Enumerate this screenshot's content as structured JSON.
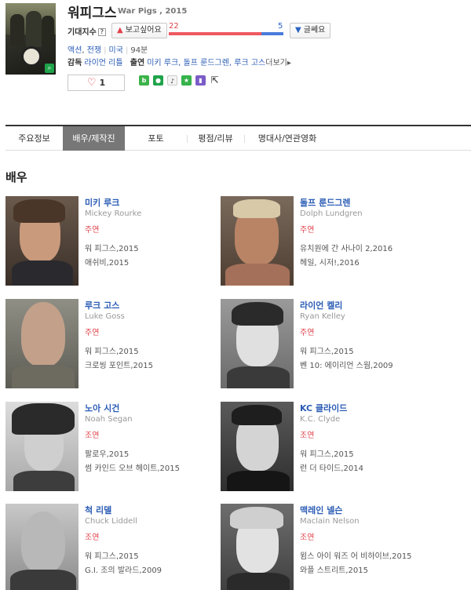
{
  "movie": {
    "title": "워피그스",
    "subtitle": "War Pigs , 2015",
    "expect_label": "기대지수",
    "help_mark": "?",
    "want_label": "보고싶어요",
    "no_label": "글쎄요",
    "want_count": "22",
    "no_count": "5",
    "want_ratio": 0.81,
    "genres": [
      "액션",
      "전쟁"
    ],
    "country": "미국",
    "runtime": "94분",
    "director_label": "감독",
    "director": "라이언 리틀",
    "cast_label": "출연",
    "cast_links": "미키 루크, 돌프 룬드그렌, 루크 고스",
    "more_label": "더보기",
    "like_count": "1"
  },
  "tabs": [
    {
      "label": "주요정보"
    },
    {
      "label": "배우/제작진"
    },
    {
      "label": "포토"
    },
    {
      "label": "평점/리뷰"
    },
    {
      "label": "명대사/연관영화"
    }
  ],
  "active_tab": 1,
  "section_title": "배우",
  "cast": [
    {
      "name": "미키 루크",
      "ename": "Mickey Rourke",
      "role": "주연",
      "films": [
        "워 피그스,2015",
        "애쉬비,2015"
      ]
    },
    {
      "name": "돌프 룬드그렌",
      "ename": "Dolph Lundgren",
      "role": "주연",
      "films": [
        "유치원에 간 사나이 2,2016",
        "헤일, 시저!,2016"
      ]
    },
    {
      "name": "루크 고스",
      "ename": "Luke Goss",
      "role": "주연",
      "films": [
        "워 피그스,2015",
        "크로씽 포인트,2015"
      ]
    },
    {
      "name": "라이언 켈리",
      "ename": "Ryan Kelley",
      "role": "주연",
      "films": [
        "워 피그스,2015",
        "벤 10: 에이리언 스웜,2009"
      ]
    },
    {
      "name": "노아 시건",
      "ename": "Noah Segan",
      "role": "조연",
      "films": [
        "팔로우,2015",
        "썸 카인드 오브 헤이트,2015"
      ]
    },
    {
      "name": "KC 클라이드",
      "ename": "K.C. Clyde",
      "role": "조연",
      "films": [
        "워 피그스,2015",
        "런 더 타이드,2014"
      ]
    },
    {
      "name": "척 리델",
      "ename": "Chuck Liddell",
      "role": "조연",
      "films": [
        "워 피그스,2015",
        "G.I. 조의 발라드,2009"
      ]
    },
    {
      "name": "맥레인 넬슨",
      "ename": "Maclain Nelson",
      "role": "조연",
      "films": [
        "윔스 아이 워즈 어 비하이브,2015",
        "와플 스트리트,2015"
      ]
    }
  ]
}
